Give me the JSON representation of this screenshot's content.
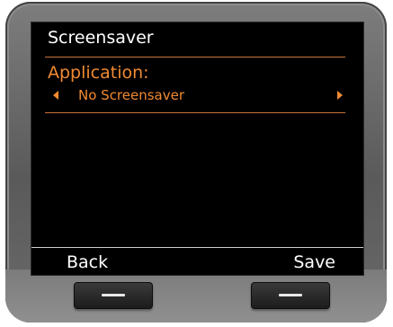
{
  "screen": {
    "title": "Screensaver",
    "field": {
      "label": "Application:",
      "value": "No Screensaver",
      "prev_icon": "triangle-left",
      "next_icon": "triangle-right"
    },
    "softkeys": {
      "left": "Back",
      "right": "Save"
    }
  },
  "colors": {
    "accent": "#f08a32",
    "screen_background": "#000000",
    "bezel": "#6e6e6e"
  }
}
